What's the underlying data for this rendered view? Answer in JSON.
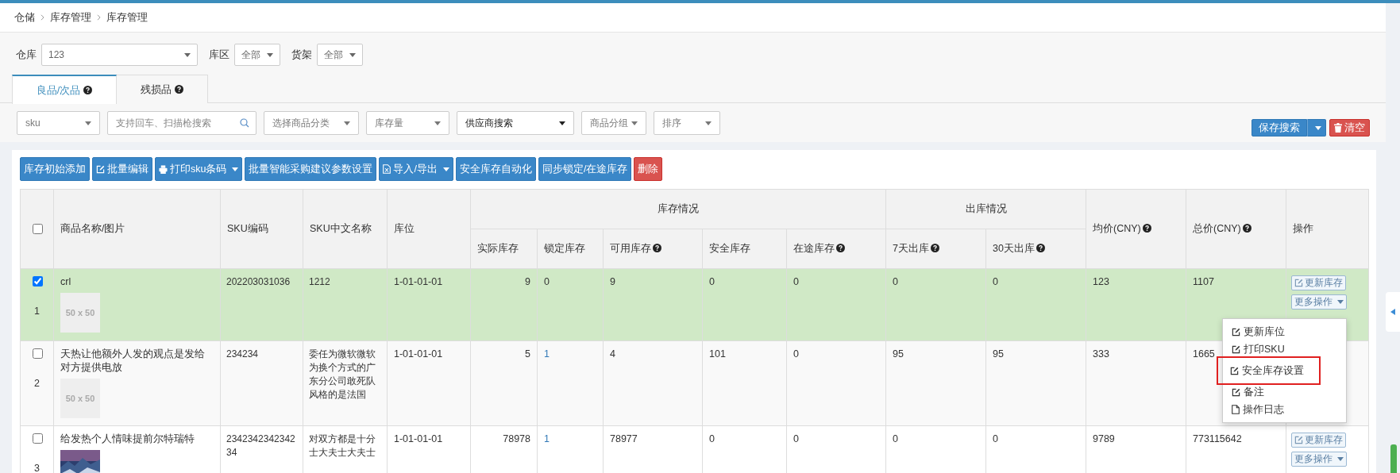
{
  "breadcrumb": [
    "仓储",
    "库存管理",
    "库存管理"
  ],
  "filters": [
    {
      "label": "仓库",
      "value": "123",
      "kind": "wide"
    },
    {
      "label": "库区",
      "value": "全部",
      "kind": "small"
    },
    {
      "label": "货架",
      "value": "全部",
      "kind": "small"
    }
  ],
  "tabs": [
    {
      "label": "良品/次品",
      "selected": true
    },
    {
      "label": "残损品",
      "selected": false
    }
  ],
  "search_fields": [
    {
      "kind": "select",
      "text": "sku"
    },
    {
      "kind": "search",
      "placeholder": "支持回车、扫描枪搜索"
    },
    {
      "kind": "select",
      "text": "选择商品分类"
    },
    {
      "kind": "select",
      "text": "库存量"
    },
    {
      "kind": "strong-select",
      "text": "供应商搜索"
    },
    {
      "kind": "select",
      "text": "商品分组"
    },
    {
      "kind": "select",
      "text": "排序"
    }
  ],
  "save_search": "保存搜索",
  "clear": "清空",
  "actions": [
    {
      "label": "库存初始添加",
      "kind": "plain",
      "caret": false
    },
    {
      "label": "批量编辑",
      "kind": "edit",
      "caret": false
    },
    {
      "label": "打印sku条码",
      "kind": "print",
      "caret": true
    },
    {
      "label": "批量智能采购建议参数设置",
      "kind": "plain",
      "caret": false
    },
    {
      "label": "导入/导出",
      "kind": "file",
      "caret": true
    },
    {
      "label": "安全库存自动化",
      "kind": "plain",
      "caret": false
    },
    {
      "label": "同步锁定/在途库存",
      "kind": "plain",
      "caret": false
    },
    {
      "label": "删除",
      "kind": "danger",
      "caret": false
    }
  ],
  "table": {
    "all_checked": false,
    "columns": [
      {
        "label": "商品名称/图片",
        "help": false
      },
      {
        "label": "SKU编码",
        "help": false
      },
      {
        "label": "SKU中文名称",
        "help": false
      },
      {
        "label": "库位",
        "help": false
      }
    ],
    "groups": [
      {
        "label": "库存情况",
        "columns": [
          {
            "label": "实际库存",
            "help": false
          },
          {
            "label": "锁定库存",
            "help": false
          },
          {
            "label": "可用库存",
            "help": true
          },
          {
            "label": "安全库存",
            "help": false
          },
          {
            "label": "在途库存",
            "help": true
          }
        ]
      },
      {
        "label": "出库情况",
        "columns": [
          {
            "label": "7天出库",
            "help": true
          },
          {
            "label": "30天出库",
            "help": true
          }
        ]
      }
    ],
    "tail_columns": [
      {
        "label": "均价(CNY)",
        "help": true
      },
      {
        "label": "总价(CNY)",
        "help": true
      },
      {
        "label": "操作",
        "help": false
      }
    ],
    "rows": [
      {
        "selected": true,
        "index": "1",
        "name": "crl",
        "image": {
          "kind": "placeholder",
          "text": "50 x 50"
        },
        "sku": "202203031036",
        "cn_name": "1212",
        "location": "1-01-01-01",
        "actual": "9",
        "locked": "0",
        "locked_link": false,
        "available": "9",
        "safety": "0",
        "in_transit": "0",
        "out7": "0",
        "out30": "0",
        "avg": "123",
        "total": "1107",
        "ops": [
          "更新库存",
          "更多操作"
        ]
      },
      {
        "selected": false,
        "index": "2",
        "name": "天热让他额外人发的观点是发给对方提供电放",
        "image": {
          "kind": "placeholder",
          "text": "50 x 50"
        },
        "sku": "234234",
        "cn_name": "委任为微软微软为换个方式的广东分公司敢死队风格的是法国",
        "location": "1-01-01-01",
        "actual": "5",
        "locked": "1",
        "locked_link": true,
        "available": "4",
        "safety": "101",
        "in_transit": "0",
        "out7": "95",
        "out30": "95",
        "avg": "333",
        "total": "1665",
        "ops": []
      },
      {
        "selected": false,
        "index": "3",
        "name": "给发热个人情味提前尔特瑞特",
        "image": {
          "kind": "picture"
        },
        "sku": "234234234234234",
        "cn_name": "对双方都是十分士大夫士大夫士",
        "location": "1-01-01-01",
        "actual": "78978",
        "locked": "1",
        "locked_link": true,
        "available": "78977",
        "safety": "0",
        "in_transit": "0",
        "out7": "0",
        "out30": "0",
        "avg": "9789",
        "total": "773115642",
        "ops": [
          "更新库存",
          "更多操作"
        ]
      }
    ]
  },
  "menu": [
    {
      "label": "更新库位",
      "kind": "edit",
      "highlighted": false
    },
    {
      "label": "打印SKU",
      "kind": "edit",
      "highlighted": false
    },
    {
      "label": "安全库存设置",
      "kind": "edit",
      "highlighted": true
    },
    {
      "label": "备注",
      "kind": "edit",
      "highlighted": false
    },
    {
      "label": "操作日志",
      "kind": "log",
      "highlighted": false
    }
  ]
}
